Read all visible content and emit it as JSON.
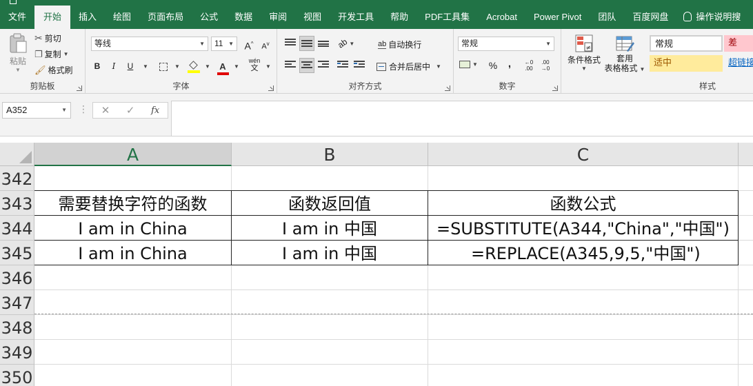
{
  "tabs": [
    {
      "label": "文件",
      "active": false
    },
    {
      "label": "开始",
      "active": true
    },
    {
      "label": "插入",
      "active": false
    },
    {
      "label": "绘图",
      "active": false
    },
    {
      "label": "页面布局",
      "active": false
    },
    {
      "label": "公式",
      "active": false
    },
    {
      "label": "数据",
      "active": false
    },
    {
      "label": "审阅",
      "active": false
    },
    {
      "label": "视图",
      "active": false
    },
    {
      "label": "开发工具",
      "active": false
    },
    {
      "label": "帮助",
      "active": false
    },
    {
      "label": "PDF工具集",
      "active": false
    },
    {
      "label": "Acrobat",
      "active": false
    },
    {
      "label": "Power Pivot",
      "active": false
    },
    {
      "label": "团队",
      "active": false
    },
    {
      "label": "百度网盘",
      "active": false
    },
    {
      "label": "操作说明搜",
      "active": false
    }
  ],
  "ribbon": {
    "clipboard": {
      "paste": "粘贴",
      "cut": "剪切",
      "copy": "复制",
      "format_painter": "格式刷",
      "label": "剪贴板"
    },
    "font": {
      "name": "等线",
      "size": "11",
      "grow": "A",
      "shrink": "A",
      "bold": "B",
      "italic": "I",
      "underline": "U",
      "phonetic_top": "wén",
      "phonetic_bottom": "文",
      "label": "字体"
    },
    "alignment": {
      "wrap_text": "自动换行",
      "merge_center": "合并后居中",
      "label": "对齐方式",
      "orientation_glyph": "ab",
      "wrap_glyph": "ab"
    },
    "number": {
      "format": "常规",
      "percent": "%",
      "comma": ",",
      "inc_decimal_top": "←0",
      "inc_decimal_bottom": ".00",
      "dec_decimal_top": ".00",
      "dec_decimal_bottom": "→0",
      "label": "数字"
    },
    "styles": {
      "conditional_format": "条件格式",
      "format_table_1": "套用",
      "format_table_2": "表格格式",
      "normal": "常规",
      "bad": "差",
      "neutral": "适中",
      "hyperlink": "超链接",
      "label": "样式"
    }
  },
  "formula_bar": {
    "name_box": "A352",
    "formula": "",
    "fx": "fx",
    "cancel": "✕",
    "enter": "✓"
  },
  "sheet": {
    "columns": [
      "A",
      "B",
      "C"
    ],
    "active_column": "A",
    "rows": [
      {
        "num": "342",
        "cells": [
          "",
          "",
          ""
        ]
      },
      {
        "num": "343",
        "cells": [
          "需要替换字符的函数",
          "函数返回值",
          "函数公式"
        ]
      },
      {
        "num": "344",
        "cells": [
          "I am in China",
          "I am in 中国",
          "=SUBSTITUTE(A344,\"China\",\"中国\")"
        ]
      },
      {
        "num": "345",
        "cells": [
          "I am in China",
          "I am in 中国",
          "=REPLACE(A345,9,5,\"中国\")"
        ]
      },
      {
        "num": "346",
        "cells": [
          "",
          "",
          ""
        ]
      },
      {
        "num": "347",
        "cells": [
          "",
          "",
          ""
        ]
      },
      {
        "num": "348",
        "cells": [
          "",
          "",
          ""
        ]
      },
      {
        "num": "349",
        "cells": [
          "",
          "",
          ""
        ]
      },
      {
        "num": "350",
        "cells": [
          "",
          "",
          ""
        ]
      }
    ]
  },
  "colors": {
    "accent": "#217346",
    "neutral_style": "#ffeb9c",
    "bad_style": "#ffc7ce",
    "hyperlink": "#0563c1"
  }
}
